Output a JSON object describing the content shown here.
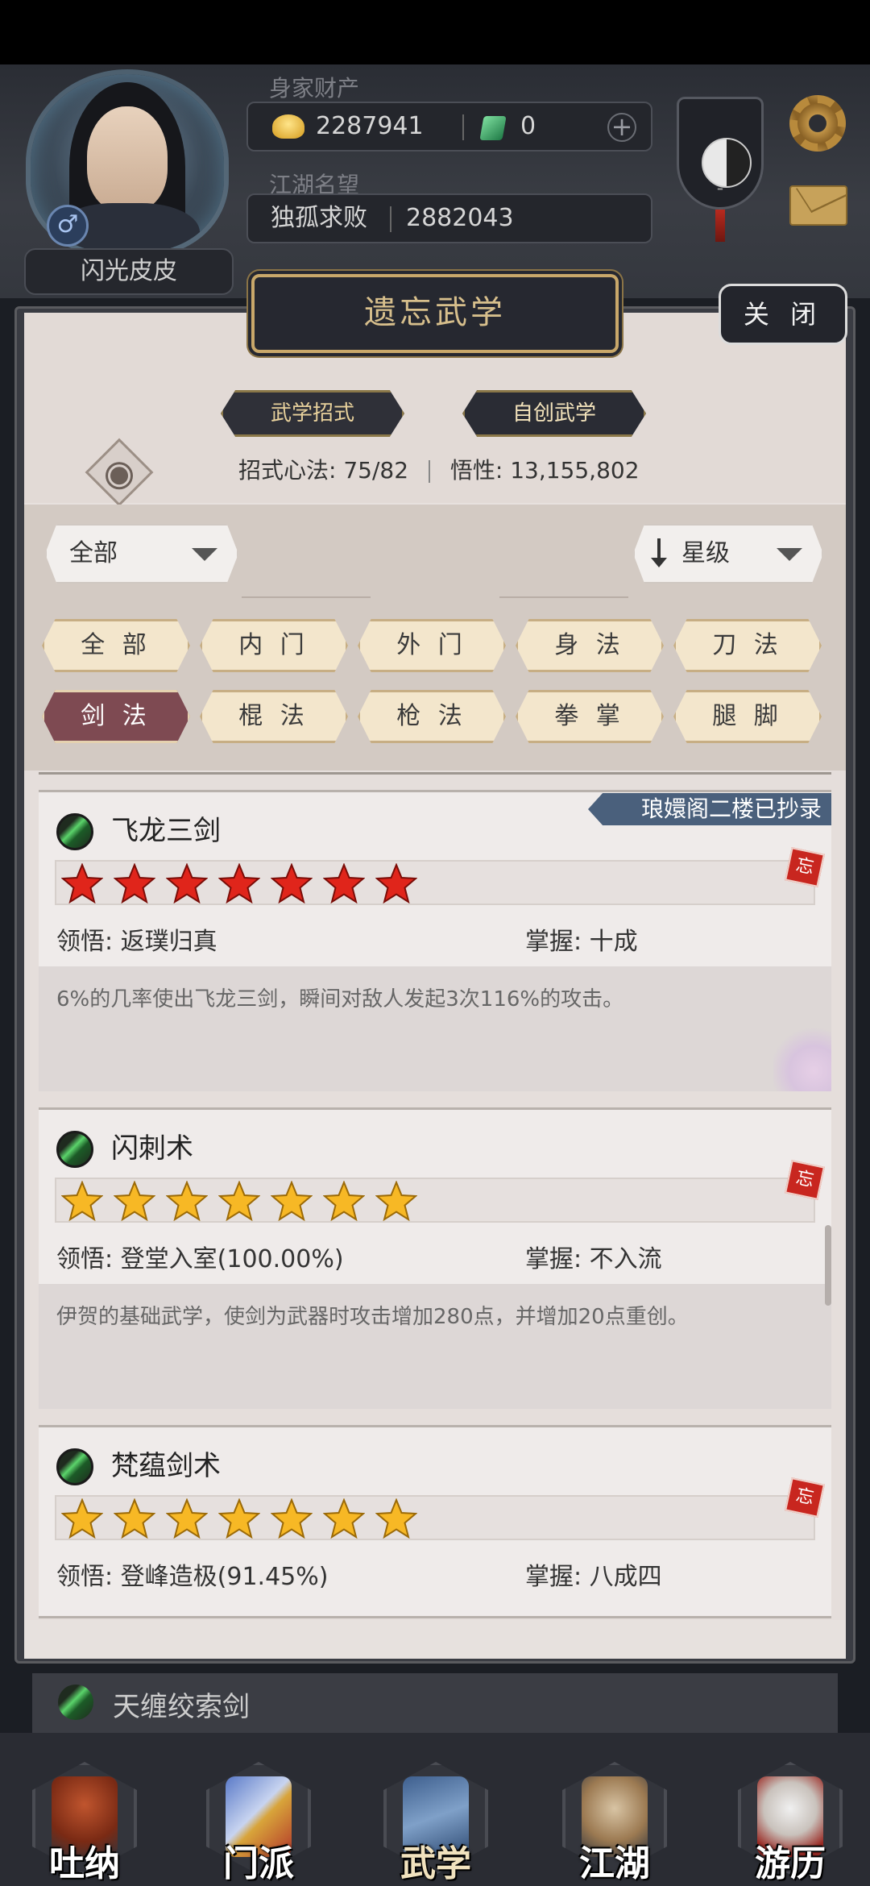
{
  "header": {
    "player_name": "闪光皮皮",
    "wealth_label": "身家财产",
    "gold": "2287941",
    "jade": "0",
    "plus": "+",
    "fame_label": "江湖名望",
    "title": "独孤求败",
    "fame": "2882043",
    "gender_symbol": "♂",
    "badge_mark": "-"
  },
  "panel": {
    "title": "遗忘武学",
    "close": "关 闭",
    "tabs": [
      "武学招式",
      "自创武学"
    ],
    "stats_label1": "招式心法:",
    "stats_value1": "75/82",
    "stats_label2": "悟性:",
    "stats_value2": "13,155,802",
    "filter_dropdown": "全部",
    "sort_dropdown": "星级"
  },
  "categories": [
    {
      "label": "全 部",
      "active": false
    },
    {
      "label": "内 门",
      "active": false
    },
    {
      "label": "外 门",
      "active": false
    },
    {
      "label": "身 法",
      "active": false
    },
    {
      "label": "刀 法",
      "active": false
    },
    {
      "label": "剑 法",
      "active": true
    },
    {
      "label": "棍 法",
      "active": false
    },
    {
      "label": "枪 法",
      "active": false
    },
    {
      "label": "拳 掌",
      "active": false
    },
    {
      "label": "腿 脚",
      "active": false
    }
  ],
  "skills": [
    {
      "name": "飞龙三剑",
      "stars": 7,
      "star_color": "red",
      "comprehension_label": "领悟:",
      "comprehension": "返璞归真",
      "mastery_label": "掌握:",
      "mastery": "十成",
      "description": "6%的几率使出飞龙三剑，瞬间对敌人发起3次116%的攻击。",
      "ribbon": "琅嬛阁二楼已抄录",
      "forget_tag": "忘"
    },
    {
      "name": "闪刺术",
      "stars": 7,
      "star_color": "gold",
      "comprehension_label": "领悟:",
      "comprehension": "登堂入室(100.00%)",
      "mastery_label": "掌握:",
      "mastery": "不入流",
      "description": "伊贺的基础武学，使剑为武器时攻击增加280点，并增加20点重创。",
      "forget_tag": "忘"
    },
    {
      "name": "梵蕴剑术",
      "stars": 7,
      "star_color": "gold",
      "comprehension_label": "领悟:",
      "comprehension": "登峰造极(91.45%)",
      "mastery_label": "掌握:",
      "mastery": "八成四",
      "forget_tag": "忘"
    }
  ],
  "peek_skill": "天缠绞索剑",
  "nav": [
    {
      "label": "吐纳",
      "icon": "meditation-icon"
    },
    {
      "label": "门派",
      "icon": "sect-icon"
    },
    {
      "label": "武学",
      "icon": "martial-books-icon",
      "active": true
    },
    {
      "label": "江湖",
      "icon": "straw-hat-icon"
    },
    {
      "label": "游历",
      "icon": "horse-icon"
    }
  ],
  "colors": {
    "accent_gold": "#c9a86a",
    "category_active": "#7e4a52",
    "star_red": "#e0251b",
    "star_gold": "#f7b825",
    "ribbon": "#4a607c"
  }
}
